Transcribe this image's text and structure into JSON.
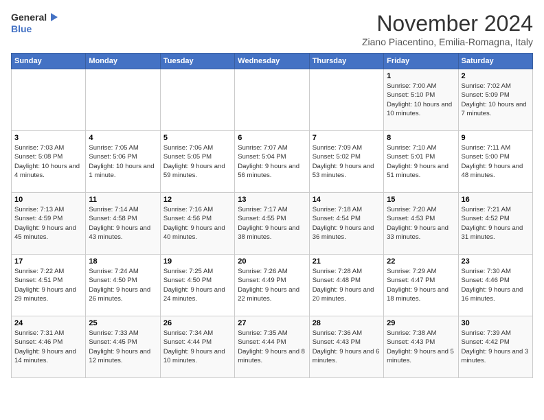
{
  "header": {
    "logo_line1": "General",
    "logo_line2": "Blue",
    "month_title": "November 2024",
    "subtitle": "Ziano Piacentino, Emilia-Romagna, Italy"
  },
  "days_of_week": [
    "Sunday",
    "Monday",
    "Tuesday",
    "Wednesday",
    "Thursday",
    "Friday",
    "Saturday"
  ],
  "weeks": [
    [
      {
        "day": "",
        "info": ""
      },
      {
        "day": "",
        "info": ""
      },
      {
        "day": "",
        "info": ""
      },
      {
        "day": "",
        "info": ""
      },
      {
        "day": "",
        "info": ""
      },
      {
        "day": "1",
        "info": "Sunrise: 7:00 AM\nSunset: 5:10 PM\nDaylight: 10 hours and 10 minutes."
      },
      {
        "day": "2",
        "info": "Sunrise: 7:02 AM\nSunset: 5:09 PM\nDaylight: 10 hours and 7 minutes."
      }
    ],
    [
      {
        "day": "3",
        "info": "Sunrise: 7:03 AM\nSunset: 5:08 PM\nDaylight: 10 hours and 4 minutes."
      },
      {
        "day": "4",
        "info": "Sunrise: 7:05 AM\nSunset: 5:06 PM\nDaylight: 10 hours and 1 minute."
      },
      {
        "day": "5",
        "info": "Sunrise: 7:06 AM\nSunset: 5:05 PM\nDaylight: 9 hours and 59 minutes."
      },
      {
        "day": "6",
        "info": "Sunrise: 7:07 AM\nSunset: 5:04 PM\nDaylight: 9 hours and 56 minutes."
      },
      {
        "day": "7",
        "info": "Sunrise: 7:09 AM\nSunset: 5:02 PM\nDaylight: 9 hours and 53 minutes."
      },
      {
        "day": "8",
        "info": "Sunrise: 7:10 AM\nSunset: 5:01 PM\nDaylight: 9 hours and 51 minutes."
      },
      {
        "day": "9",
        "info": "Sunrise: 7:11 AM\nSunset: 5:00 PM\nDaylight: 9 hours and 48 minutes."
      }
    ],
    [
      {
        "day": "10",
        "info": "Sunrise: 7:13 AM\nSunset: 4:59 PM\nDaylight: 9 hours and 45 minutes."
      },
      {
        "day": "11",
        "info": "Sunrise: 7:14 AM\nSunset: 4:58 PM\nDaylight: 9 hours and 43 minutes."
      },
      {
        "day": "12",
        "info": "Sunrise: 7:16 AM\nSunset: 4:56 PM\nDaylight: 9 hours and 40 minutes."
      },
      {
        "day": "13",
        "info": "Sunrise: 7:17 AM\nSunset: 4:55 PM\nDaylight: 9 hours and 38 minutes."
      },
      {
        "day": "14",
        "info": "Sunrise: 7:18 AM\nSunset: 4:54 PM\nDaylight: 9 hours and 36 minutes."
      },
      {
        "day": "15",
        "info": "Sunrise: 7:20 AM\nSunset: 4:53 PM\nDaylight: 9 hours and 33 minutes."
      },
      {
        "day": "16",
        "info": "Sunrise: 7:21 AM\nSunset: 4:52 PM\nDaylight: 9 hours and 31 minutes."
      }
    ],
    [
      {
        "day": "17",
        "info": "Sunrise: 7:22 AM\nSunset: 4:51 PM\nDaylight: 9 hours and 29 minutes."
      },
      {
        "day": "18",
        "info": "Sunrise: 7:24 AM\nSunset: 4:50 PM\nDaylight: 9 hours and 26 minutes."
      },
      {
        "day": "19",
        "info": "Sunrise: 7:25 AM\nSunset: 4:50 PM\nDaylight: 9 hours and 24 minutes."
      },
      {
        "day": "20",
        "info": "Sunrise: 7:26 AM\nSunset: 4:49 PM\nDaylight: 9 hours and 22 minutes."
      },
      {
        "day": "21",
        "info": "Sunrise: 7:28 AM\nSunset: 4:48 PM\nDaylight: 9 hours and 20 minutes."
      },
      {
        "day": "22",
        "info": "Sunrise: 7:29 AM\nSunset: 4:47 PM\nDaylight: 9 hours and 18 minutes."
      },
      {
        "day": "23",
        "info": "Sunrise: 7:30 AM\nSunset: 4:46 PM\nDaylight: 9 hours and 16 minutes."
      }
    ],
    [
      {
        "day": "24",
        "info": "Sunrise: 7:31 AM\nSunset: 4:46 PM\nDaylight: 9 hours and 14 minutes."
      },
      {
        "day": "25",
        "info": "Sunrise: 7:33 AM\nSunset: 4:45 PM\nDaylight: 9 hours and 12 minutes."
      },
      {
        "day": "26",
        "info": "Sunrise: 7:34 AM\nSunset: 4:44 PM\nDaylight: 9 hours and 10 minutes."
      },
      {
        "day": "27",
        "info": "Sunrise: 7:35 AM\nSunset: 4:44 PM\nDaylight: 9 hours and 8 minutes."
      },
      {
        "day": "28",
        "info": "Sunrise: 7:36 AM\nSunset: 4:43 PM\nDaylight: 9 hours and 6 minutes."
      },
      {
        "day": "29",
        "info": "Sunrise: 7:38 AM\nSunset: 4:43 PM\nDaylight: 9 hours and 5 minutes."
      },
      {
        "day": "30",
        "info": "Sunrise: 7:39 AM\nSunset: 4:42 PM\nDaylight: 9 hours and 3 minutes."
      }
    ]
  ]
}
